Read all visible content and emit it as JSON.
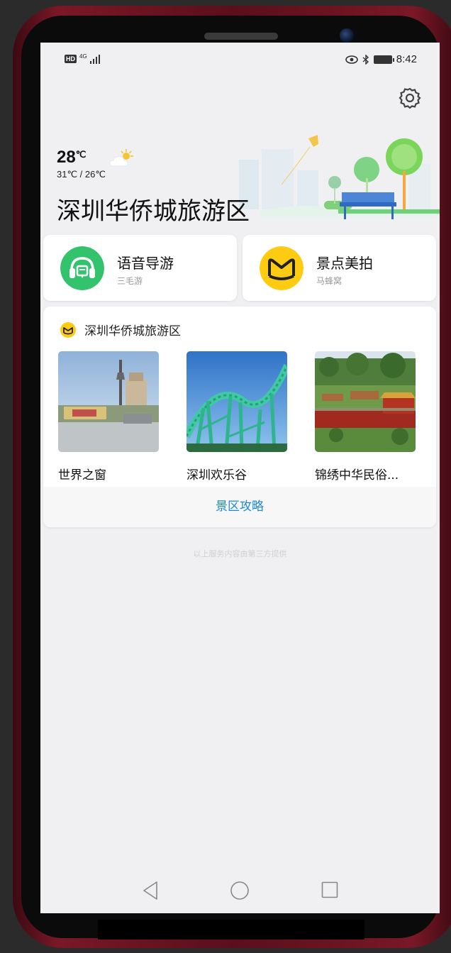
{
  "status_bar": {
    "hd": "HD",
    "network": "4G",
    "time": "8:42"
  },
  "weather": {
    "current_temp": "28",
    "unit": "℃",
    "range": "31℃ / 26℃"
  },
  "header": {
    "title": "深圳华侨城旅游区"
  },
  "quick_actions": [
    {
      "title": "语音导游",
      "subtitle": "三毛游",
      "icon": "headphones-icon",
      "color": "#34c36d"
    },
    {
      "title": "景点美拍",
      "subtitle": "马蜂窝",
      "icon": "mafengwo-icon",
      "color": "#fecb13"
    }
  ],
  "guide": {
    "title": "深圳华侨城旅游区",
    "spots": [
      {
        "name": "世界之窗"
      },
      {
        "name": "深圳欢乐谷"
      },
      {
        "name": "锦绣中华民俗..."
      }
    ],
    "footer_link": "景区攻略"
  },
  "footnote": "以上服务内容由第三方提供",
  "colors": {
    "accent_link": "#1e88d8",
    "screen_bg": "#f0f0f2"
  }
}
